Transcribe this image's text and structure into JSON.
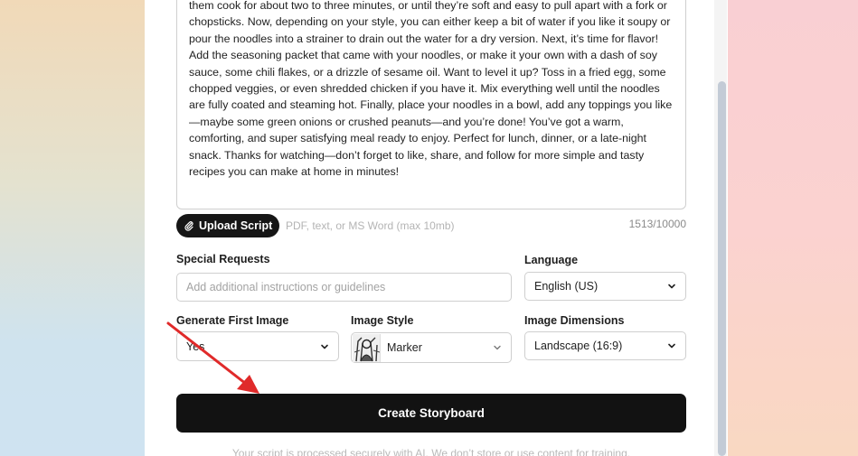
{
  "script": {
    "text": "them cook for about two to three minutes, or until they’re soft and easy to pull apart with a fork or chopsticks. Now, depending on your style, you can either keep a bit of water if you like it soupy or pour the noodles into a strainer to drain out the water for a dry version. Next, it’s time for flavor! Add the seasoning packet that came with your noodles, or make it your own with a dash of soy sauce, some chili flakes, or a drizzle of sesame oil. Want to level it up? Toss in a fried egg, some chopped veggies, or even shredded chicken if you have it. Mix everything well until the noodles are fully coated and steaming hot. Finally, place your noodles in a bowl, add any toppings you like—maybe some green onions or crushed peanuts—and you’re done! You’ve got a warm, comforting, and super satisfying meal ready to enjoy. Perfect for lunch, dinner, or a late-night snack. Thanks for watching—don’t forget to like, share, and follow for more simple and tasty recipes you can make at home in minutes!"
  },
  "upload": {
    "button_label": "Upload Script",
    "hint": "PDF, text, or MS Word (max 10mb)",
    "char_count": "1513/10000"
  },
  "special_requests": {
    "label": "Special Requests",
    "placeholder": "Add additional instructions or guidelines"
  },
  "language": {
    "label": "Language",
    "value": "English (US)"
  },
  "first_image": {
    "label": "Generate First Image",
    "value": "Yes"
  },
  "image_style": {
    "label": "Image Style",
    "value": "Marker"
  },
  "image_dimensions": {
    "label": "Image Dimensions",
    "value": "Landscape (16:9)"
  },
  "create": {
    "label": "Create Storyboard"
  },
  "footer": {
    "note": "Your script is processed securely with AI. We don’t store or use content for training."
  },
  "colors": {
    "primary_button": "#121212",
    "annotation_arrow": "#e02a2a"
  }
}
